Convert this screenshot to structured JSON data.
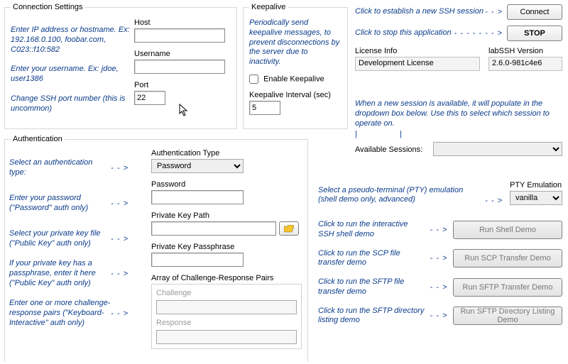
{
  "conn": {
    "legend": "Connection Settings",
    "hint_ip": "Enter IP address or hostname. Ex: 192.168.0.100, foobar.com, C023::f10:582",
    "hint_user": "Enter your username. Ex: jdoe, user1386",
    "hint_port": "Change SSH port number (this is uncommon)",
    "host_label": "Host",
    "host_value": "",
    "user_label": "Username",
    "user_value": "",
    "port_label": "Port",
    "port_value": "22"
  },
  "keep": {
    "legend": "Keepalive",
    "desc": "Periodically send keepalive messages, to prevent disconnections by the server due to inactivity.",
    "enable_label": "Enable Keepalive",
    "interval_label": "Keepalive Interval (sec)",
    "interval_value": "5"
  },
  "top": {
    "connect_hint": "Click to establish a new SSH session",
    "connect_btn": "Connect",
    "stop_hint": "Click to stop this application",
    "stop_btn": "STOP",
    "lic_label": "License Info",
    "lic_value": "Development License",
    "ver_label": "labSSH Version",
    "ver_value": "2.6.0-981c4e6",
    "sess_hint": "When a new session is available, it will populate in the dropdown box below. Use this to select which session to operate on.",
    "sess_label": "Available Sessions:"
  },
  "auth": {
    "legend": "Authentication",
    "hint_type": "Select an authentication type:",
    "hint_pw": "Enter your password (\"Password\" auth only)",
    "hint_pk": "Select your private key file (\"Public Key\" auth only)",
    "hint_pp": "If your private key has a passphrase, enter it here (\"Public Key\" auth only)",
    "hint_cr": "Enter one or more challenge-response pairs (\"Keyboard-Interactive\" auth only)",
    "type_label": "Authentication Type",
    "type_value": "Password",
    "pw_label": "Password",
    "pw_value": "",
    "pk_label": "Private Key Path",
    "pk_value": "",
    "pp_label": "Private Key Passphrase",
    "pp_value": "",
    "cr_label": "Array of Challenge-Response Pairs",
    "cr_challenge": "Challenge",
    "cr_response": "Response"
  },
  "pty": {
    "hint": "Select a pseudo-terminal (PTY) emulation (shell demo only, advanced)",
    "label": "PTY Emulation",
    "value": "vanilla"
  },
  "demos": {
    "shell_hint": "Click to run the interactive SSH shell demo",
    "shell_btn": "Run Shell Demo",
    "scp_hint": "Click to run the SCP file transfer demo",
    "scp_btn": "Run SCP Transfer Demo",
    "sftpt_hint": "Click to run the SFTP file transfer demo",
    "sftpt_btn": "Run SFTP Transfer Demo",
    "sftpd_hint": "Click to run the SFTP directory listing demo",
    "sftpd_btn": "Run SFTP Directory Listing Demo"
  },
  "arrows": {
    "right": "- - >",
    "rlong": "- - - - - - - >",
    "down": "|"
  }
}
